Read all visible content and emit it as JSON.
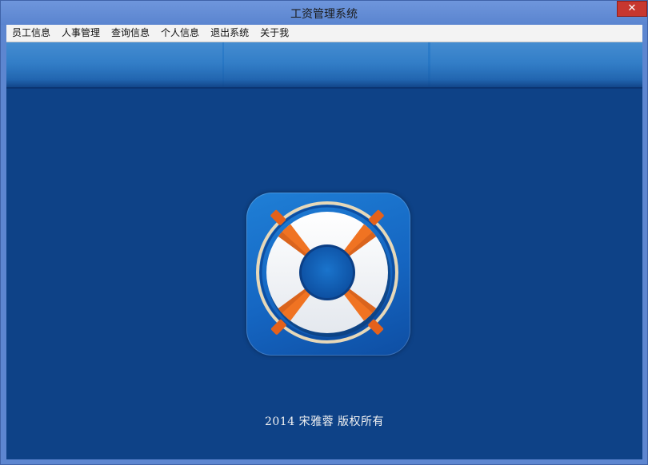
{
  "window": {
    "title": "工资管理系统",
    "close_glyph": "✕"
  },
  "menu": [
    "员工信息",
    "人事管理",
    "查询信息",
    "个人信息",
    "退出系统",
    "关于我"
  ],
  "footer": {
    "copyright": "2014  宋雅蓉  版权所有"
  },
  "logo": {
    "icon": "lifebuoy-icon"
  },
  "colors": {
    "client_bg": "#0e4287",
    "tile_bg": "#1566c2",
    "ring_orange": "#ef6c1e",
    "ring_white": "#ffffff"
  }
}
